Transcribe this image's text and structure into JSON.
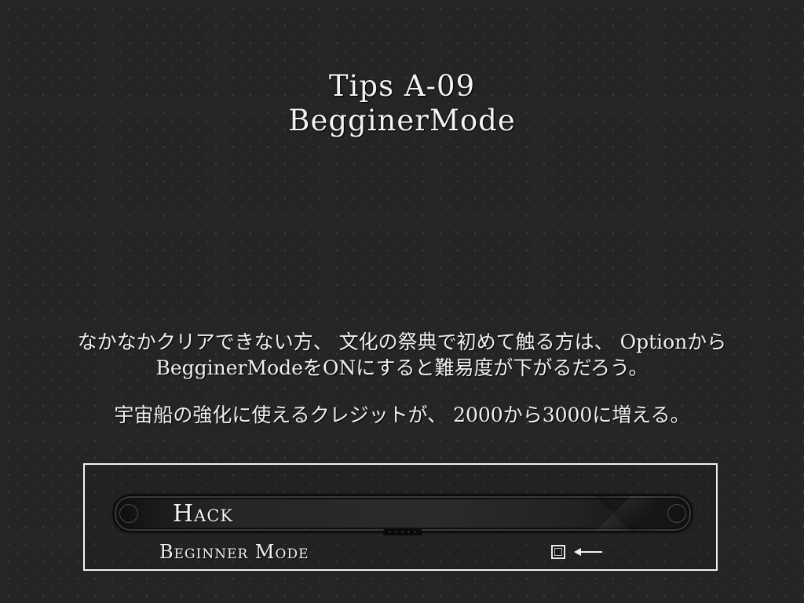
{
  "tips": {
    "title_line1": "Tips A-09",
    "title_line2": "BegginerMode",
    "body": [
      "なかなかクリアできない方、 文化の祭典で初めて触る方は、 Optionから",
      "BegginerModeをONにすると難易度が下がるだろう。",
      "宇宙船の強化に使えるクレジットが、 2000から3000に増える。"
    ]
  },
  "options_panel": {
    "section_title": "Hack",
    "bar_dots": "・・・・・",
    "rows": [
      {
        "label": "Beginner Mode",
        "checked": false,
        "pointer_icon": "left-arrow-icon"
      }
    ]
  },
  "colors": {
    "background": "#252525",
    "text": "#f2f2f2",
    "panel_border": "#f2f2f2"
  }
}
